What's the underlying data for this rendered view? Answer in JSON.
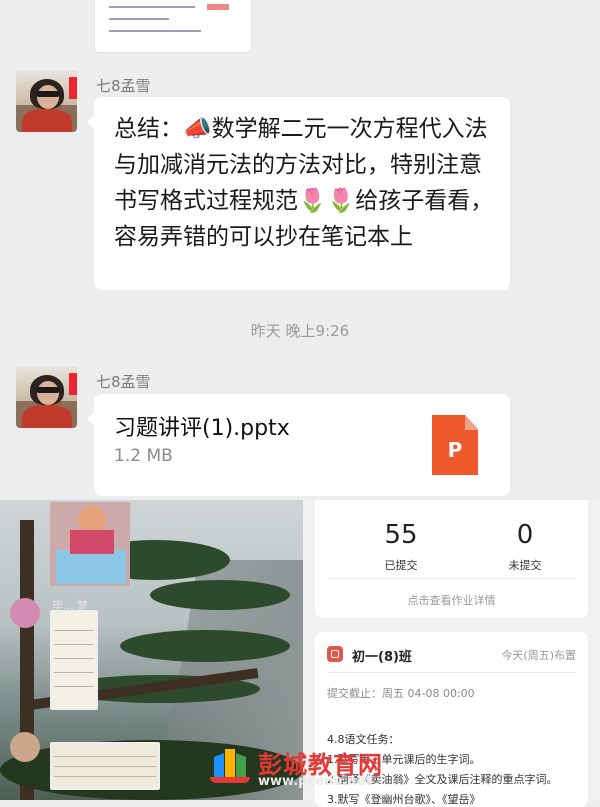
{
  "messages": [
    {
      "sender": "七8孟雪",
      "text": "总结：📣数学解二元一次方程代入法与加减消元法的方法对比，特别注意书写格式过程规范🌷🌷给孩子看看，容易弄错的可以抄在笔记本上"
    },
    {
      "sender": "七8孟雪",
      "file_name": "习题讲评(1).pptx",
      "file_size": "1.2 MB",
      "file_icon_letter": "P"
    }
  ],
  "timestamp": "昨天 晚上9:26",
  "video": {
    "participant_label": "毕... 梦"
  },
  "homework": {
    "submitted_count": "55",
    "submitted_label": "已提交",
    "unsubmitted_count": "0",
    "unsubmitted_label": "未提交",
    "view_details": "点击查看作业详情",
    "class_name": "初一(8)班",
    "posted_time": "今天(周五)布置",
    "deadline": "提交截止：周五 04-08 00:00",
    "tasks": [
      "4.8语文任务：",
      "1.默写第三单元课后的生字词。",
      "2.翻译《卖油翁》全文及课后注释的重点字词。",
      "3.默写《登幽州台歌》、《望岳》"
    ]
  },
  "watermark": {
    "text": "彭城教育网",
    "url": "www.pcedu.net"
  },
  "colors": {
    "chat_background": "#ededed",
    "ppt_orange": "#ee5a2b",
    "accent_red": "#e0584a"
  }
}
